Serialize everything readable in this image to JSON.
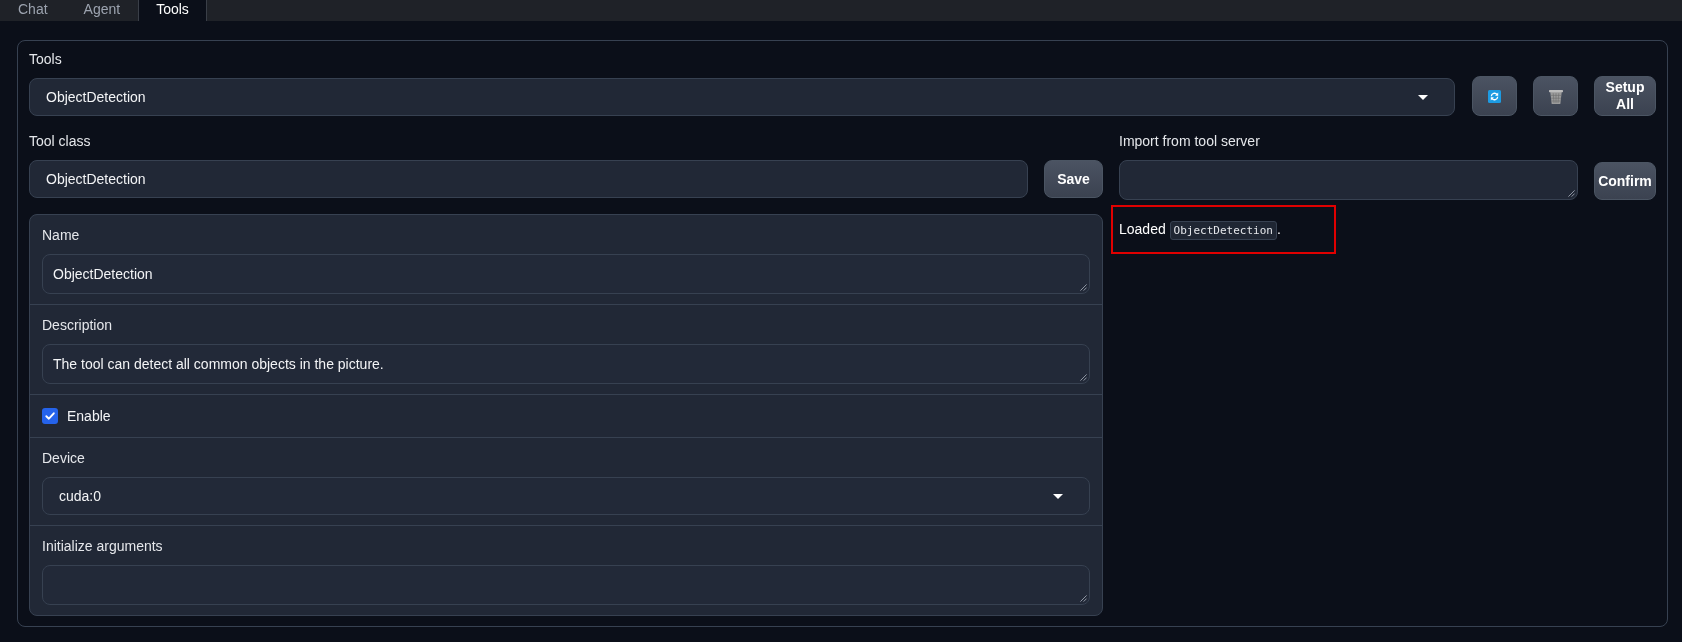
{
  "tabs": [
    {
      "label": "Chat",
      "selected": false
    },
    {
      "label": "Agent",
      "selected": false
    },
    {
      "label": "Tools",
      "selected": true
    }
  ],
  "tools": {
    "label": "Tools",
    "value": "ObjectDetection",
    "buttons": [
      {
        "kind": "refresh"
      },
      {
        "kind": "trash"
      },
      {
        "kind": "text",
        "label": "Setup All"
      }
    ]
  },
  "tool_class": {
    "label": "Tool class",
    "value": "ObjectDetection",
    "button": "Save"
  },
  "form": {
    "fields": [
      {
        "kind": "textarea",
        "label": "Name",
        "value": "ObjectDetection"
      },
      {
        "kind": "textarea",
        "label": "Description",
        "value": "The tool can detect all common objects in the picture."
      },
      {
        "kind": "checkbox",
        "label": "Enable",
        "checked": true
      },
      {
        "kind": "select",
        "label": "Device",
        "value": "cuda:0"
      },
      {
        "kind": "textarea",
        "label": "Initialize arguments"
      }
    ]
  },
  "import": {
    "label": "Import from tool server",
    "button": "Confirm"
  },
  "status": {
    "highlighted": true,
    "parts": [
      {
        "kind": "text",
        "text": "Loaded "
      },
      {
        "kind": "code",
        "text": "ObjectDetection"
      },
      {
        "kind": "text",
        "text": "."
      }
    ]
  }
}
